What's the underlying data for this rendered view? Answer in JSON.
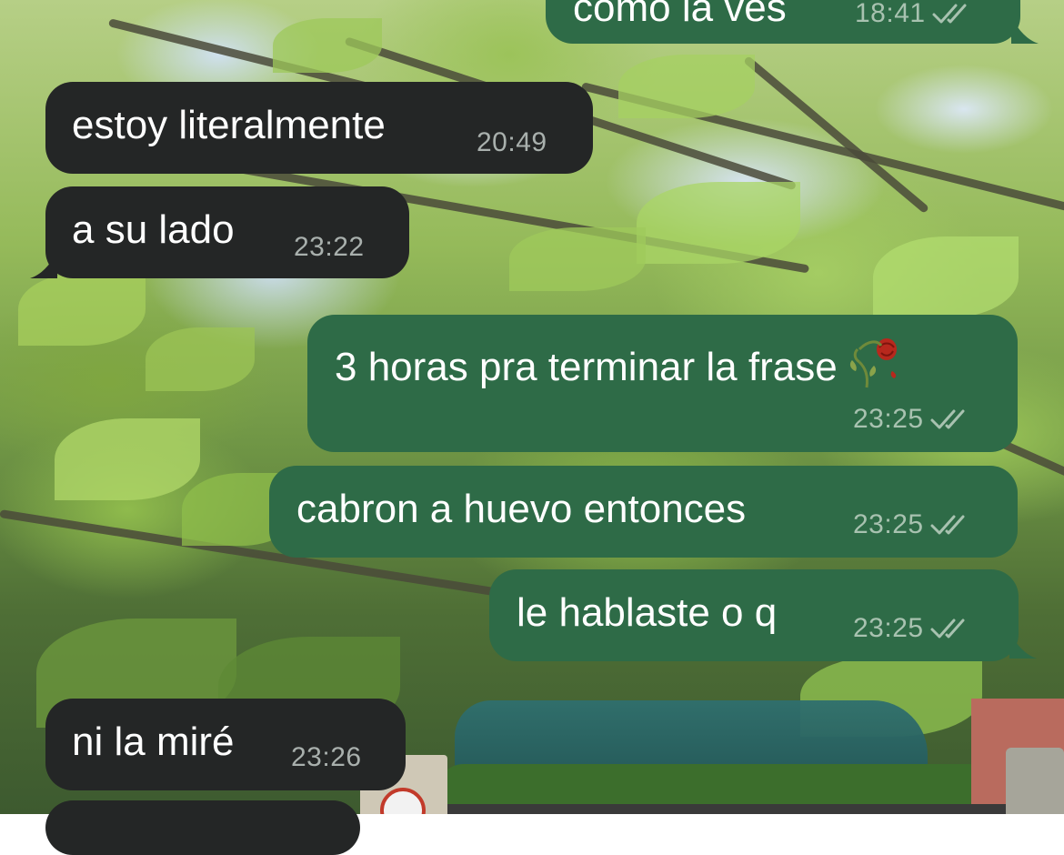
{
  "chat": {
    "messages": [
      {
        "id": "m0",
        "direction": "outgoing",
        "text": "como la ves",
        "time": "18:41",
        "status": "read",
        "status_icon": "double-check-icon"
      },
      {
        "id": "m1",
        "direction": "incoming",
        "text": "estoy literalmente",
        "time": "20:49"
      },
      {
        "id": "m2",
        "direction": "incoming",
        "text": "a su lado",
        "time": "23:22"
      },
      {
        "id": "m3",
        "direction": "outgoing",
        "text": "3 horas pra terminar la frase",
        "emoji": "wilted-rose-emoji",
        "time": "23:25",
        "status": "read",
        "status_icon": "double-check-icon"
      },
      {
        "id": "m4",
        "direction": "outgoing",
        "text": "cabron a huevo entonces",
        "time": "23:25",
        "status": "read",
        "status_icon": "double-check-icon"
      },
      {
        "id": "m5",
        "direction": "outgoing",
        "text": "le hablaste o q",
        "time": "23:25",
        "status": "read",
        "status_icon": "double-check-icon"
      },
      {
        "id": "m6",
        "direction": "incoming",
        "text": "ni la miré",
        "time": "23:26"
      }
    ]
  },
  "colors": {
    "incoming_bubble": "#242626",
    "outgoing_bubble": "#2e6b47",
    "text": "#ffffff",
    "meta_incoming": "#a9b0ad",
    "meta_outgoing": "#a8c2b0"
  }
}
